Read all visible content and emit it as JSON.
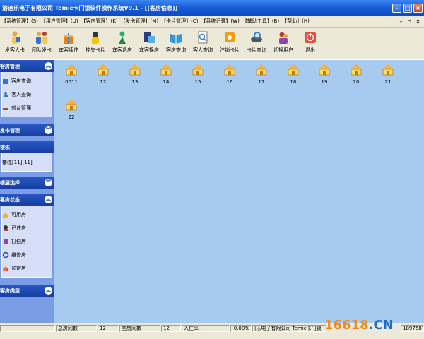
{
  "window": {
    "title": "溶迪乐电子有限公司 Temic卡门锁软件操作系统V9.1 - [(客房信息)]"
  },
  "menu": [
    {
      "label": "【系统管理】(S)"
    },
    {
      "label": "【用户管理】(U)"
    },
    {
      "label": "【客房管理】(K)"
    },
    {
      "label": "【发卡管理】(M)"
    },
    {
      "label": "【卡片管理】(C)"
    },
    {
      "label": "【系统记录】(W)"
    },
    {
      "label": "【辅助工具】(B)"
    },
    {
      "label": "【帮助】(H)"
    }
  ],
  "toolbar": [
    {
      "label": "发客人卡",
      "icon": "person-card-icon"
    },
    {
      "label": "团队发卡",
      "icon": "group-card-icon"
    },
    {
      "label": "宾客续住",
      "icon": "gift-icon"
    },
    {
      "label": "挂失卡片",
      "icon": "report-lost-icon"
    },
    {
      "label": "宾客退房",
      "icon": "checkout-icon"
    },
    {
      "label": "宾客换房",
      "icon": "change-room-icon"
    },
    {
      "label": "客房查询",
      "icon": "book-icon"
    },
    {
      "label": "客人查询",
      "icon": "guest-search-icon"
    },
    {
      "label": "注销卡片",
      "icon": "cancel-card-icon"
    },
    {
      "label": "卡片查询",
      "icon": "card-search-icon"
    },
    {
      "label": "切换用户",
      "icon": "switch-user-icon"
    },
    {
      "label": "退出",
      "icon": "exit-icon"
    }
  ],
  "sidebar": {
    "room_manage": {
      "title": "客房管理",
      "items": [
        {
          "label": "客房查询",
          "icon": "room-query-icon"
        },
        {
          "label": "客人查询",
          "icon": "guest-query-icon"
        },
        {
          "label": "前台管理",
          "icon": "front-desk-icon"
        }
      ]
    },
    "card_manage": {
      "title": "发卡管理"
    },
    "building": {
      "title": "楼栋",
      "item": "楼栋[11][11]"
    },
    "floor": {
      "title": "楼层选择"
    },
    "status": {
      "title": "客房状态",
      "items": [
        {
          "label": "可用房",
          "icon": "available-room-icon"
        },
        {
          "label": "已住房",
          "icon": "occupied-room-icon"
        },
        {
          "label": "打扫房",
          "icon": "cleaning-room-icon"
        },
        {
          "label": "维修房",
          "icon": "repair-room-icon"
        },
        {
          "label": "预定房",
          "icon": "reserved-room-icon"
        }
      ]
    },
    "room_type": {
      "title": "客房类型"
    }
  },
  "rooms": [
    "0011",
    "12",
    "13",
    "14",
    "15",
    "16",
    "17",
    "18",
    "19",
    "20",
    "21",
    "22"
  ],
  "statusbar": {
    "total_label": "总房间数",
    "total_value": "12",
    "empty_label": "空房间数",
    "empty_value": "12",
    "occupancy_label": "入住率",
    "occupancy_value": "0.00%",
    "company": "|乐电子有限公司 Temic卡门锁",
    "phone": "18975873"
  },
  "colors": {
    "main_bg": "#a6caf0",
    "panel_bg": "#7a9de6",
    "section_head": "#1a4bb8"
  },
  "watermark": {
    "part1": "16618",
    "part2": ".CN"
  }
}
